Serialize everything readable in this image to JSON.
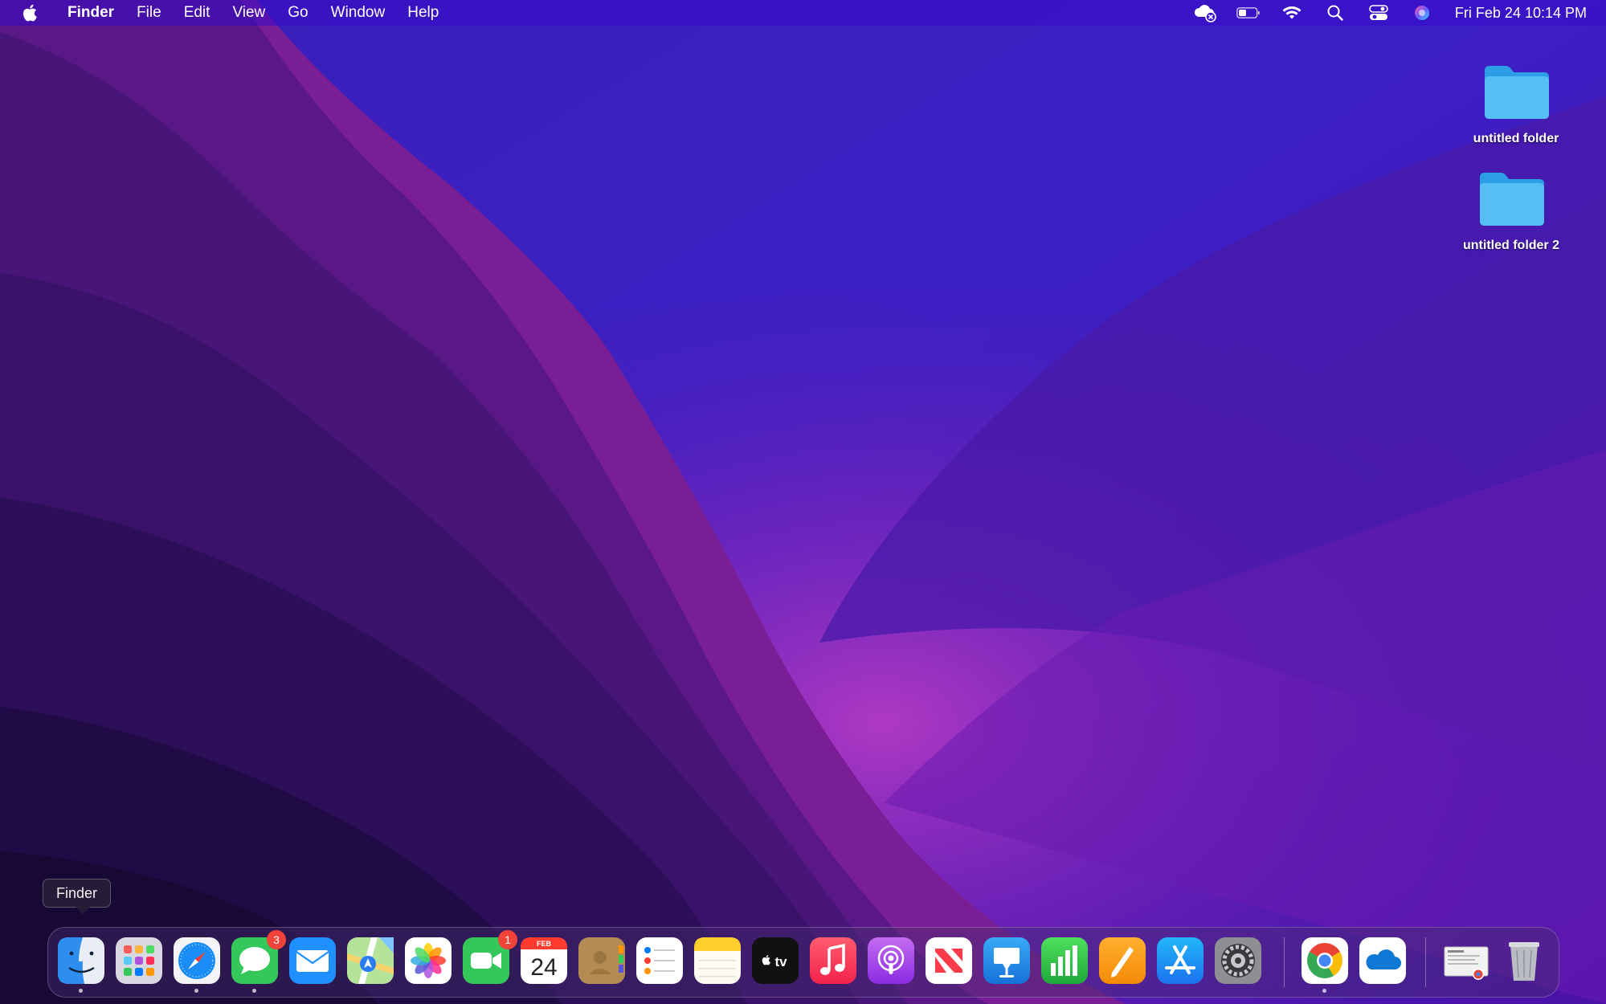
{
  "menubar": {
    "items": [
      "Finder",
      "File",
      "Edit",
      "View",
      "Go",
      "Window",
      "Help"
    ],
    "clock": "Fri Feb 24  10:14 PM",
    "status_icons": [
      "icloud-error-icon",
      "battery-icon",
      "wifi-icon",
      "spotlight-search-icon",
      "control-center-icon",
      "siri-icon"
    ]
  },
  "desktop": {
    "items": [
      {
        "label": "untitled folder"
      },
      {
        "label": "untitled folder 2"
      }
    ]
  },
  "tooltip": {
    "text": "Finder"
  },
  "dock": {
    "apps": [
      "Finder",
      "Launchpad",
      "Safari",
      "Messages",
      "Mail",
      "Maps",
      "Photos",
      "FaceTime",
      "Calendar",
      "Contacts",
      "Reminders",
      "Notes",
      "TV",
      "Music",
      "Podcasts",
      "News",
      "Keynote",
      "Numbers",
      "Pages",
      "App Store",
      "System Preferences",
      "Google Chrome",
      "OneDrive",
      "Screenshot",
      "Trash"
    ],
    "badges": {
      "messages": "3",
      "facetime": "1"
    },
    "calendar": {
      "month": "FEB",
      "day": "24"
    },
    "tv_label": "tv"
  },
  "colors": {
    "folder": "#3fb4f2",
    "menubar": "#3a10c8",
    "badge": "#f2433a"
  }
}
